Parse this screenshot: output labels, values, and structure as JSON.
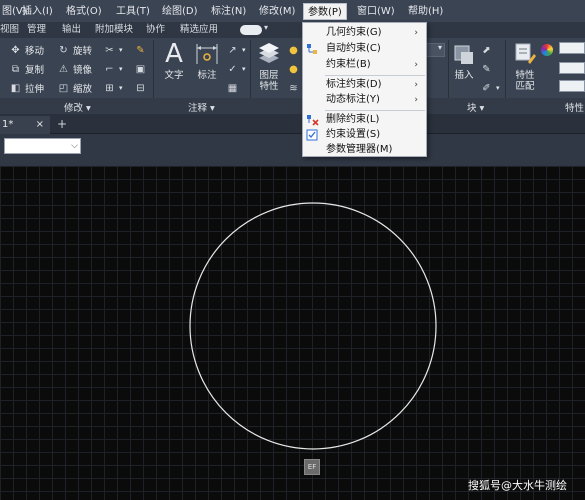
{
  "menubar": {
    "items": [
      "图(V)",
      "插入(I)",
      "格式(O)",
      "工具(T)",
      "绘图(D)",
      "标注(N)",
      "修改(M)",
      "参数(P)",
      "窗口(W)",
      "帮助(H)"
    ],
    "active": "参数(P)"
  },
  "ribbon_tabs": [
    "视图",
    "管理",
    "输出",
    "附加模块",
    "协作",
    "精选应用"
  ],
  "ribbon": {
    "modify": {
      "tools": [
        "移动",
        "旋转",
        "复制",
        "镜像",
        "拉伸",
        "缩放"
      ],
      "label": "修改"
    },
    "annotation": {
      "text": "文字",
      "dimension": "标注",
      "label": "注释"
    },
    "layers": {
      "properties": "图层\n特性"
    },
    "block": {
      "insert": "插入",
      "label": "块"
    },
    "properties": {
      "match": "特性\n匹配",
      "label": "特性"
    }
  },
  "doc_tab": {
    "name": "1*",
    "close": "×",
    "new": "+"
  },
  "dropdown": {
    "items": [
      {
        "label": "几何约束(G)",
        "submenu": true,
        "icon": false
      },
      {
        "label": "自动约束(C)",
        "submenu": false,
        "icon": true
      },
      {
        "label": "约束栏(B)",
        "submenu": true,
        "icon": false
      },
      {
        "label": "标注约束(D)",
        "submenu": true,
        "icon": false
      },
      {
        "label": "动态标注(Y)",
        "submenu": true,
        "icon": false
      },
      {
        "label": "删除约束(L)",
        "submenu": false,
        "icon": true
      },
      {
        "label": "约束设置(S)",
        "submenu": false,
        "icon": true
      },
      {
        "label": "参数管理器(M)",
        "submenu": false,
        "icon": false
      }
    ]
  },
  "canvas": {
    "shape": "circle"
  },
  "watermark": "搜狐号@大水牛测绘",
  "colors": {
    "background": "#0b0b0b",
    "ribbon": "#3a4351",
    "menu": "#3b4453",
    "circle": "#e8e8e8"
  }
}
